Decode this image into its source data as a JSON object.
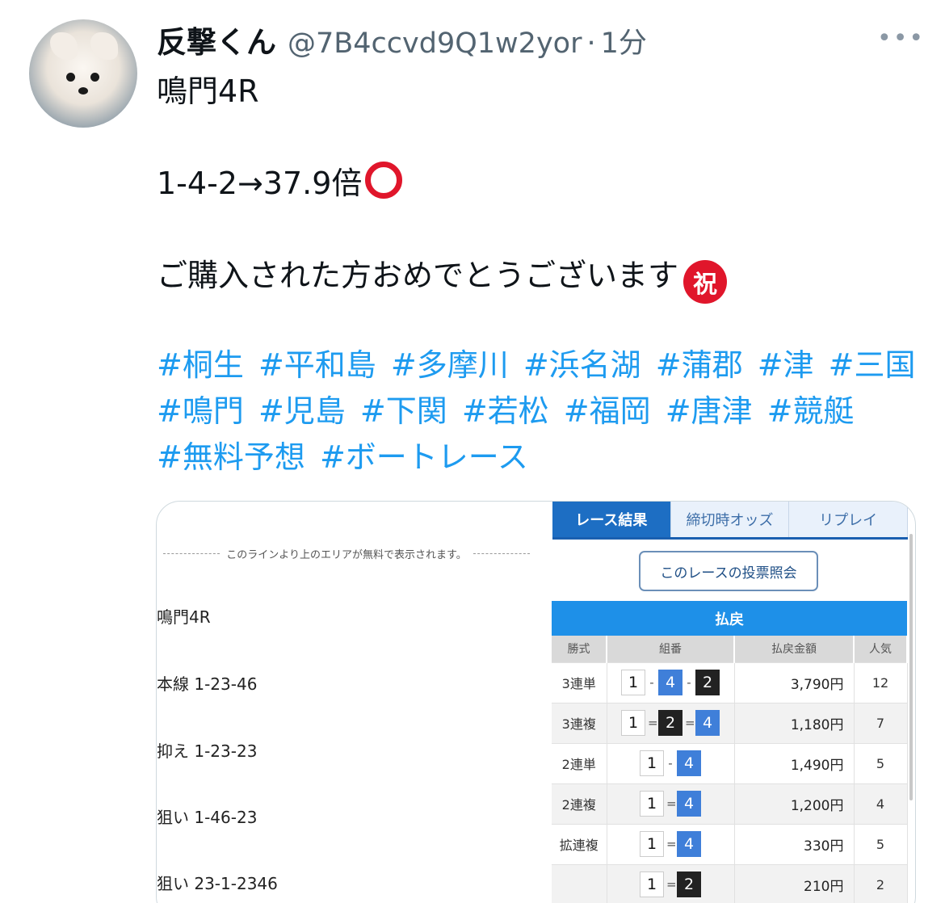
{
  "tweet": {
    "display_name": "反撃くん",
    "handle": "@7B4ccvd9Q1w2yor",
    "separator": "·",
    "time": "1分",
    "more_icon": "•••",
    "line1": "鳴門4R",
    "line2": "1-4-2→37.9倍",
    "line3": "ご購入された方おめでとうございます",
    "iwai_char": "祝",
    "hashtags": [
      "#桐生",
      "#平和島",
      "#多摩川",
      "#浜名湖",
      "#蒲郡",
      "#津",
      "#三国",
      "#鳴門",
      "#児島",
      "#下関",
      "#若松",
      "#福岡",
      "#唐津",
      "#競艇",
      "#無料予想",
      "#ボートレース"
    ]
  },
  "card": {
    "free_line_text": "このラインより上のエリアが無料で表示されます。",
    "predictions": [
      "鳴門4R",
      "本線 1-23-46",
      "抑え 1-23-23",
      "狙い 1-46-23",
      "狙い 23-1-2346"
    ],
    "tabs": [
      "レース結果",
      "締切時オッズ",
      "リプレイ"
    ],
    "inquiry_button": "このレースの投票照会",
    "payout": {
      "title": "払戻",
      "headers": [
        "勝式",
        "組番",
        "払戻金額",
        "人気"
      ],
      "rows": [
        {
          "type": "3連単",
          "combo": [
            "1",
            "-",
            "4",
            "-",
            "2"
          ],
          "amount": "3,790円",
          "pop": "12"
        },
        {
          "type": "3連複",
          "combo": [
            "1",
            "=",
            "2",
            "=",
            "4"
          ],
          "amount": "1,180円",
          "pop": "7"
        },
        {
          "type": "2連単",
          "combo": [
            "1",
            "-",
            "4"
          ],
          "amount": "1,490円",
          "pop": "5"
        },
        {
          "type": "2連複",
          "combo": [
            "1",
            "=",
            "4"
          ],
          "amount": "1,200円",
          "pop": "4"
        },
        {
          "type": "拡連複",
          "combo": [
            "1",
            "=",
            "4"
          ],
          "amount": "330円",
          "pop": "5"
        },
        {
          "type": "",
          "combo": [
            "1",
            "=",
            "2"
          ],
          "amount": "210円",
          "pop": "2"
        }
      ]
    },
    "colors": {
      "boat1": "#ffffff",
      "boat2": "#222222",
      "boat4": "#3f7fd9",
      "header_blue": "#1e90e8",
      "hashtag": "#1d9bf0"
    }
  }
}
